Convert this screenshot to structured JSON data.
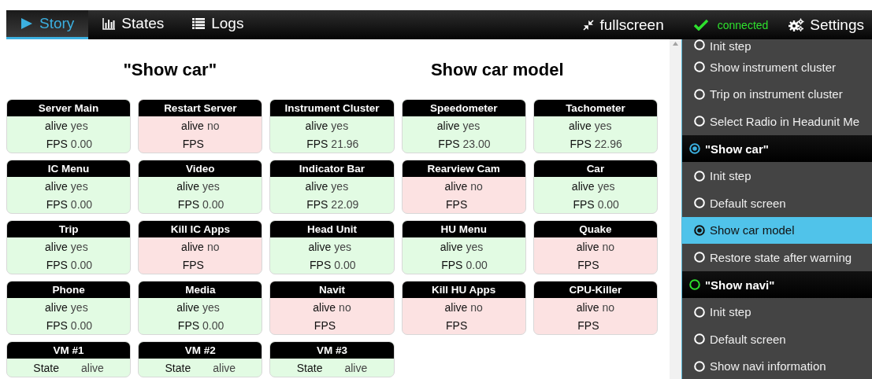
{
  "navbar": {
    "tabs": [
      {
        "label": "Story",
        "kind": "play",
        "selected": true
      },
      {
        "label": "States",
        "kind": "bars",
        "selected": false
      },
      {
        "label": "Logs",
        "kind": "list",
        "selected": false
      }
    ],
    "actions": [
      {
        "label": "fullscreen",
        "kind": "fullscreen"
      },
      {
        "label": "connected",
        "kind": "status"
      },
      {
        "label": "Settings",
        "kind": "settings"
      }
    ]
  },
  "headings": [
    "\"Show car\"",
    "Show car model"
  ],
  "cards": [
    {
      "title": "Server Main",
      "healthy": true,
      "rows": [
        {
          "label": "alive",
          "value": "yes"
        },
        {
          "label": "FPS",
          "value": "0.00"
        }
      ]
    },
    {
      "title": "Restart Server",
      "healthy": false,
      "rows": [
        {
          "label": "alive",
          "value": "no"
        },
        {
          "label": "FPS"
        }
      ]
    },
    {
      "title": "Instrument Cluster",
      "healthy": true,
      "rows": [
        {
          "label": "alive",
          "value": "yes"
        },
        {
          "label": "FPS",
          "value": "21.96"
        }
      ]
    },
    {
      "title": "Speedometer",
      "healthy": true,
      "rows": [
        {
          "label": "alive",
          "value": "yes"
        },
        {
          "label": "FPS",
          "value": "23.00"
        }
      ]
    },
    {
      "title": "Tachometer",
      "healthy": true,
      "rows": [
        {
          "label": "alive",
          "value": "yes"
        },
        {
          "label": "FPS",
          "value": "22.96"
        }
      ]
    },
    {
      "title": "IC Menu",
      "healthy": true,
      "rows": [
        {
          "label": "alive",
          "value": "yes"
        },
        {
          "label": "FPS",
          "value": "0.00"
        }
      ]
    },
    {
      "title": "Video",
      "healthy": true,
      "rows": [
        {
          "label": "alive",
          "value": "yes"
        },
        {
          "label": "FPS",
          "value": "0.00"
        }
      ]
    },
    {
      "title": "Indicator Bar",
      "healthy": true,
      "rows": [
        {
          "label": "alive",
          "value": "yes"
        },
        {
          "label": "FPS",
          "value": "22.09"
        }
      ]
    },
    {
      "title": "Rearview Cam",
      "healthy": false,
      "rows": [
        {
          "label": "alive",
          "value": "no"
        },
        {
          "label": "FPS"
        }
      ]
    },
    {
      "title": "Car",
      "healthy": true,
      "rows": [
        {
          "label": "alive",
          "value": "yes"
        },
        {
          "label": "FPS",
          "value": "0.00"
        }
      ]
    },
    {
      "title": "Trip",
      "healthy": true,
      "rows": [
        {
          "label": "alive",
          "value": "yes"
        },
        {
          "label": "FPS",
          "value": "0.00"
        }
      ]
    },
    {
      "title": "Kill IC Apps",
      "healthy": false,
      "rows": [
        {
          "label": "alive",
          "value": "no"
        },
        {
          "label": "FPS"
        }
      ]
    },
    {
      "title": "Head Unit",
      "healthy": true,
      "rows": [
        {
          "label": "alive",
          "value": "yes"
        },
        {
          "label": "FPS",
          "value": "0.00"
        }
      ]
    },
    {
      "title": "HU Menu",
      "healthy": true,
      "rows": [
        {
          "label": "alive",
          "value": "yes"
        },
        {
          "label": "FPS",
          "value": "0.00"
        }
      ]
    },
    {
      "title": "Quake",
      "healthy": false,
      "rows": [
        {
          "label": "alive",
          "value": "no"
        },
        {
          "label": "FPS"
        }
      ]
    },
    {
      "title": "Phone",
      "healthy": true,
      "rows": [
        {
          "label": "alive",
          "value": "yes"
        },
        {
          "label": "FPS",
          "value": "0.00"
        }
      ]
    },
    {
      "title": "Media",
      "healthy": true,
      "rows": [
        {
          "label": "alive",
          "value": "yes"
        },
        {
          "label": "FPS",
          "value": "0.00"
        }
      ]
    },
    {
      "title": "Navit",
      "healthy": false,
      "rows": [
        {
          "label": "alive",
          "value": "no"
        },
        {
          "label": "FPS"
        }
      ]
    },
    {
      "title": "Kill HU Apps",
      "healthy": false,
      "rows": [
        {
          "label": "alive",
          "value": "no"
        },
        {
          "label": "FPS"
        }
      ]
    },
    {
      "title": "CPU-Killer",
      "healthy": false,
      "rows": [
        {
          "label": "alive",
          "value": "no"
        },
        {
          "label": "FPS"
        }
      ]
    },
    {
      "title": "VM #1",
      "healthy": true,
      "rows": [
        {
          "label": "State",
          "value": "alive"
        }
      ]
    },
    {
      "title": "VM #2",
      "healthy": true,
      "rows": [
        {
          "label": "State",
          "value": "alive"
        }
      ]
    },
    {
      "title": "VM #3",
      "healthy": true,
      "rows": [
        {
          "label": "State",
          "value": "alive"
        }
      ]
    }
  ],
  "sidebar": {
    "items": [
      {
        "kind": "step",
        "label": "Init step",
        "selected": false
      },
      {
        "kind": "step",
        "label": "Show instrument cluster",
        "selected": false
      },
      {
        "kind": "step",
        "label": "Trip on instrument cluster",
        "selected": false
      },
      {
        "kind": "step",
        "label": "Select Radio in Headunit Me",
        "selected": false
      },
      {
        "kind": "story",
        "label": "\"Show car\"",
        "current": true
      },
      {
        "kind": "step",
        "label": "Init step",
        "selected": false
      },
      {
        "kind": "step",
        "label": "Default screen",
        "selected": false
      },
      {
        "kind": "step",
        "label": "Show car model",
        "selected": true
      },
      {
        "kind": "step",
        "label": "Restore state after warning",
        "selected": false
      },
      {
        "kind": "story",
        "label": "\"Show navi\"",
        "current": false
      },
      {
        "kind": "step",
        "label": "Init step",
        "selected": false
      },
      {
        "kind": "step",
        "label": "Default screen",
        "selected": false
      },
      {
        "kind": "step",
        "label": "Show navi information",
        "selected": false
      }
    ]
  }
}
